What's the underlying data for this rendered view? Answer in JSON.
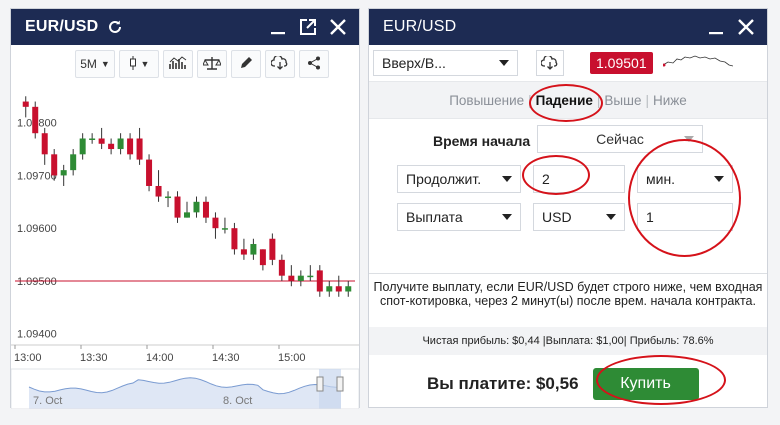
{
  "left_panel": {
    "title": "EUR/USD",
    "toolbar": {
      "timeframe": "5M",
      "icons": [
        "candlestick-icon",
        "indicators-icon",
        "balance-icon",
        "pencil-icon",
        "cloud-download-icon",
        "share-icon"
      ]
    }
  },
  "chart_data": {
    "type": "candlestick",
    "y_ticks": [
      "1.09800",
      "1.09700",
      "1.09600",
      "1.09500",
      "1.09400"
    ],
    "y_values": [
      1.098,
      1.097,
      1.096,
      1.095,
      1.094
    ],
    "x_ticks": [
      "13:00",
      "13:30",
      "14:00",
      "14:30",
      "15:00"
    ],
    "ylim": [
      1.0939,
      1.0986
    ],
    "current_price_line": 1.095,
    "candles": [
      {
        "o": 1.0984,
        "c": 1.0983,
        "h": 1.0985,
        "l": 1.0981
      },
      {
        "o": 1.0983,
        "c": 1.0978,
        "h": 1.0984,
        "l": 1.0977
      },
      {
        "o": 1.0978,
        "c": 1.0974,
        "h": 1.0979,
        "l": 1.0972
      },
      {
        "o": 1.0974,
        "c": 1.097,
        "h": 1.0975,
        "l": 1.0969
      },
      {
        "o": 1.097,
        "c": 1.0971,
        "h": 1.0972,
        "l": 1.0968
      },
      {
        "o": 1.0971,
        "c": 1.0974,
        "h": 1.0975,
        "l": 1.097
      },
      {
        "o": 1.0974,
        "c": 1.0977,
        "h": 1.0978,
        "l": 1.0973
      },
      {
        "o": 1.0977,
        "c": 1.0977,
        "h": 1.0978,
        "l": 1.0976
      },
      {
        "o": 1.0977,
        "c": 1.0976,
        "h": 1.0979,
        "l": 1.0975
      },
      {
        "o": 1.0976,
        "c": 1.0975,
        "h": 1.0977,
        "l": 1.0974
      },
      {
        "o": 1.0975,
        "c": 1.0977,
        "h": 1.0978,
        "l": 1.0974
      },
      {
        "o": 1.0977,
        "c": 1.0974,
        "h": 1.0978,
        "l": 1.0973
      },
      {
        "o": 1.0977,
        "c": 1.0973,
        "h": 1.0979,
        "l": 1.0972
      },
      {
        "o": 1.0973,
        "c": 1.0968,
        "h": 1.0974,
        "l": 1.0967
      },
      {
        "o": 1.0968,
        "c": 1.0966,
        "h": 1.0971,
        "l": 1.0965
      },
      {
        "o": 1.0966,
        "c": 1.0966,
        "h": 1.0967,
        "l": 1.0964
      },
      {
        "o": 1.0966,
        "c": 1.0962,
        "h": 1.0967,
        "l": 1.0961
      },
      {
        "o": 1.0962,
        "c": 1.0963,
        "h": 1.0965,
        "l": 1.0962
      },
      {
        "o": 1.0963,
        "c": 1.0965,
        "h": 1.0966,
        "l": 1.0962
      },
      {
        "o": 1.0965,
        "c": 1.0962,
        "h": 1.0966,
        "l": 1.0961
      },
      {
        "o": 1.0962,
        "c": 1.096,
        "h": 1.0963,
        "l": 1.0958
      },
      {
        "o": 1.096,
        "c": 1.096,
        "h": 1.0962,
        "l": 1.0959
      },
      {
        "o": 1.096,
        "c": 1.0956,
        "h": 1.0961,
        "l": 1.0955
      },
      {
        "o": 1.0956,
        "c": 1.0955,
        "h": 1.0958,
        "l": 1.0954
      },
      {
        "o": 1.0955,
        "c": 1.0957,
        "h": 1.0958,
        "l": 1.0954
      },
      {
        "o": 1.0956,
        "c": 1.0953,
        "h": 1.0956,
        "l": 1.0952
      },
      {
        "o": 1.0958,
        "c": 1.0954,
        "h": 1.0959,
        "l": 1.0953
      },
      {
        "o": 1.0954,
        "c": 1.0951,
        "h": 1.0955,
        "l": 1.095
      },
      {
        "o": 1.0951,
        "c": 1.095,
        "h": 1.0953,
        "l": 1.0949
      },
      {
        "o": 1.095,
        "c": 1.0951,
        "h": 1.0952,
        "l": 1.0949
      },
      {
        "o": 1.0951,
        "c": 1.0951,
        "h": 1.0953,
        "l": 1.095
      },
      {
        "o": 1.0952,
        "c": 1.0948,
        "h": 1.0953,
        "l": 1.0947
      },
      {
        "o": 1.0948,
        "c": 1.0949,
        "h": 1.095,
        "l": 1.0947
      },
      {
        "o": 1.0949,
        "c": 1.0948,
        "h": 1.0951,
        "l": 1.0947
      },
      {
        "o": 1.0948,
        "c": 1.0949,
        "h": 1.095,
        "l": 1.0947
      }
    ],
    "navigator": {
      "labels": [
        "7. Oct",
        "8. Oct"
      ]
    },
    "colors": {
      "up": "#2e8b35",
      "down": "#c8102e",
      "line": "#c8102e",
      "navigator": "#7a9bd1"
    }
  },
  "right_panel": {
    "title": "EUR/USD",
    "direction_select": "Вверх/В...",
    "price": "1.09501",
    "tabs": [
      "Повышение",
      "Падение",
      "Выше",
      "Ниже"
    ],
    "active_tab_index": 1,
    "start_time_label": "Время начала",
    "start_time_value": "Сейчас",
    "duration_select": "Продолжит.",
    "duration_value": "2",
    "duration_unit": "мин.",
    "payout_select": "Выплата",
    "currency_select": "USD",
    "amount_value": "1",
    "info_text": "Получите выплату, если EUR/USD будет строго ниже, чем входная спот-котировка, через 2 минут(ы) после врем. начала контракта.",
    "summary": "Чистая прибыль: $0,44 |Выплата: $1,00| Прибыль: 78.6%",
    "pay_label": "Вы платите: $0,56",
    "buy_label": "Купить"
  },
  "colors": {
    "header": "#1d2b53",
    "accent_red": "#c8102e",
    "buy_green": "#2e8b35",
    "annotation": "#d5121a"
  }
}
